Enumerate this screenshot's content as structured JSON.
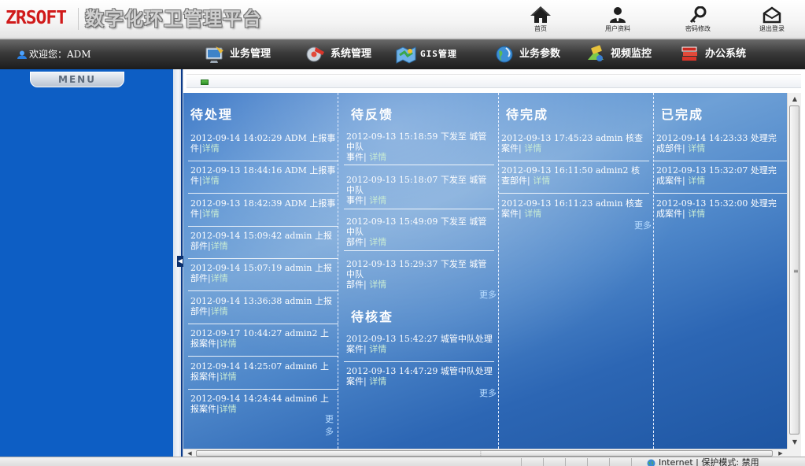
{
  "header": {
    "logo": "ZRSOFT",
    "title": "数字化环卫管理平台",
    "links": [
      {
        "label": "首页",
        "icon": "home-icon"
      },
      {
        "label": "用户资料",
        "icon": "user-profile-icon"
      },
      {
        "label": "密码修改",
        "icon": "key-icon"
      },
      {
        "label": "退出登录",
        "icon": "logout-envelope-icon"
      }
    ]
  },
  "nav": {
    "welcome": "欢迎您：ADM",
    "items": [
      {
        "label": "业务管理",
        "icon": "monitor-icon"
      },
      {
        "label": "系统管理",
        "icon": "gear-icon"
      },
      {
        "label": "GIS管理",
        "icon": "map-icon"
      },
      {
        "label": "业务参数",
        "icon": "globe-icon"
      },
      {
        "label": "视频监控",
        "icon": "video-icon"
      },
      {
        "label": "办公系统",
        "icon": "books-icon"
      }
    ]
  },
  "sidebar": {
    "menu_label": "MENU"
  },
  "main": {
    "detail_label": "详情",
    "more_label": "更多",
    "columns": [
      {
        "title": "待处理",
        "entries": [
          {
            "text": "2012-09-14 14:02:29 ADM 上报事件"
          },
          {
            "text": "2012-09-13 18:44:16 ADM 上报事件"
          },
          {
            "text": "2012-09-13 18:42:39 ADM 上报事件"
          },
          {
            "text": "2012-09-14 15:09:42 admin 上报部件"
          },
          {
            "text": "2012-09-14 15:07:19 admin 上报部件"
          },
          {
            "text": "2012-09-14 13:36:38 admin 上报部件"
          },
          {
            "text": "2012-09-17 10:44:27 admin2 上报案件"
          },
          {
            "text": "2012-09-14 14:25:07 admin6 上报案件"
          },
          {
            "text": "2012-09-14 14:24:44 admin6 上报案件"
          }
        ]
      },
      {
        "title": "待反馈",
        "entries": [
          {
            "text": "2012-09-13 15:18:59 下发至 城管中队",
            "type": "事件"
          },
          {
            "text": "2012-09-13 15:18:07 下发至 城管中队",
            "type": "事件"
          },
          {
            "text": "2012-09-13 15:49:09 下发至 城管中队",
            "type": "部件"
          },
          {
            "text": "2012-09-13 15:29:37 下发至 城管中队",
            "type": "部件"
          }
        ]
      },
      {
        "title": "待完成",
        "entries": [
          {
            "text": "2012-09-13 17:45:23 admin 核查案件"
          },
          {
            "text": "2012-09-13 16:11:50 admin2 核查部件"
          },
          {
            "text": "2012-09-13 16:11:23 admin 核查案件"
          }
        ]
      },
      {
        "title": "已完成",
        "entries": [
          {
            "text": "2012-09-14 14:23:33 处理完成部件"
          },
          {
            "text": "2012-09-13 15:32:07 处理完成案件"
          },
          {
            "text": "2012-09-13 15:32:00 处理完成案件"
          }
        ]
      }
    ],
    "review": {
      "title": "待核查",
      "entries": [
        {
          "text": "2012-09-13 15:42:27 城管中队处理案件"
        },
        {
          "text": "2012-09-13 14:47:29 城管中队处理案件"
        }
      ]
    }
  },
  "statusbar": {
    "zone": "Internet | 保护模式: 禁用"
  },
  "colors": {
    "sidebar": "#0d5ec4",
    "logo": "#d01a1a",
    "detail_link": "#c9ecd4",
    "navbar": "#2a2a2a"
  }
}
